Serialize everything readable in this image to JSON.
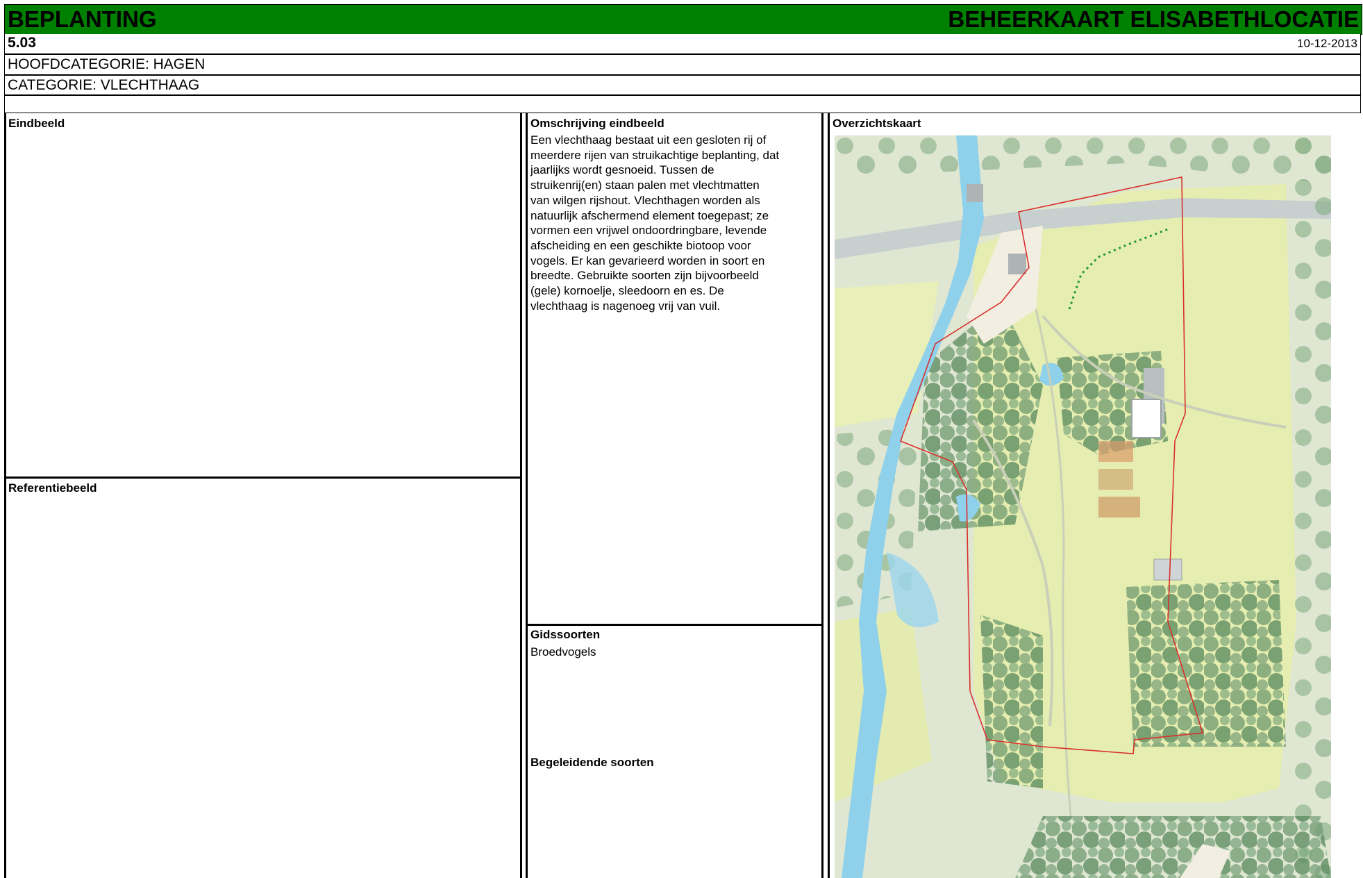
{
  "header": {
    "left_title": "BEPLANTING",
    "right_title": "BEHEERKAART ELISABETHLOCATIE",
    "code": "5.03",
    "date": "10-12-2013",
    "main_category": "HOOFDCATEGORIE: HAGEN",
    "category": "CATEGORIE: VLECHTHAAG"
  },
  "sections": {
    "eindbeeld": "Eindbeeld",
    "referentiebeeld": "Referentiebeeld",
    "omschrijving_title": "Omschrijving eindbeeld",
    "omschrijving_lines": [
      "Een vlechthaag bestaat uit een gesloten rij of",
      "meerdere rijen van struikachtige beplanting, dat",
      "jaarlijks wordt gesnoeid. Tussen de",
      "struikenrij(en) staan palen met vlechtmatten",
      "van wilgen rijshout. Vlechthagen worden als",
      "natuurlijk afschermend element toegepast; ze",
      "vormen een vrijwel ondoordringbare, levende",
      "afscheiding en een geschikte biotoop voor",
      "vogels. Er kan gevarieerd worden in soort en",
      "breedte. Gebruikte soorten zijn bijvoorbeeld",
      "(gele) kornoelje, sleedoorn en es. De",
      "vlechthaag is nagenoeg vrij van vuil."
    ],
    "gidssoorten_title": "Gidssoorten",
    "gidssoorten_value": "Broedvogels",
    "begeleidende_title": "Begeleidende soorten",
    "overzichtskaart": "Overzichtskaart"
  },
  "colors": {
    "header_green": "#008000",
    "boundary_red": "#d9302c",
    "hedge_green": "#1f9a2e",
    "water_blue": "#7fc8e6",
    "grass_yellow": "#e6edb0",
    "forest_green": "#5f8f63"
  }
}
